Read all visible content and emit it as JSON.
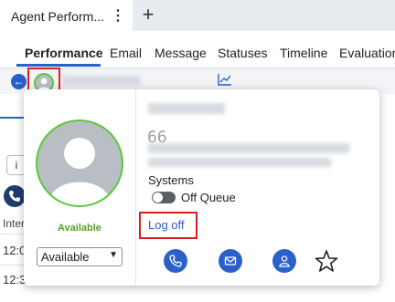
{
  "window": {
    "tab_title": "Agent Perform...",
    "tab_menu_icon": "kebab-menu-icon",
    "new_tab_icon": "plus-icon"
  },
  "subtabs": [
    {
      "label": "Performance",
      "active": true
    },
    {
      "label": "Email",
      "active": false
    },
    {
      "label": "Message",
      "active": false
    },
    {
      "label": "Statuses",
      "active": false
    },
    {
      "label": "Timeline",
      "active": false
    },
    {
      "label": "Evaluations",
      "active": false
    }
  ],
  "background": {
    "info_icon": "i",
    "column_label": "Inter",
    "rows": [
      "12:0",
      "12:3"
    ]
  },
  "profile_card": {
    "presence_status": "Available",
    "status_select_value": "Available",
    "queue_number_partial": "66",
    "systems_label": "Systems",
    "queue_label": "Off Queue",
    "queue_on": false,
    "log_off_label": "Log off",
    "actions": [
      "phone-icon",
      "email-icon",
      "user-icon",
      "star-icon"
    ]
  },
  "colors": {
    "accent": "#2a60c9",
    "presence_green": "#5cc73c",
    "available_text": "#5a9e2a",
    "highlight_frame": "#d81e1e"
  }
}
